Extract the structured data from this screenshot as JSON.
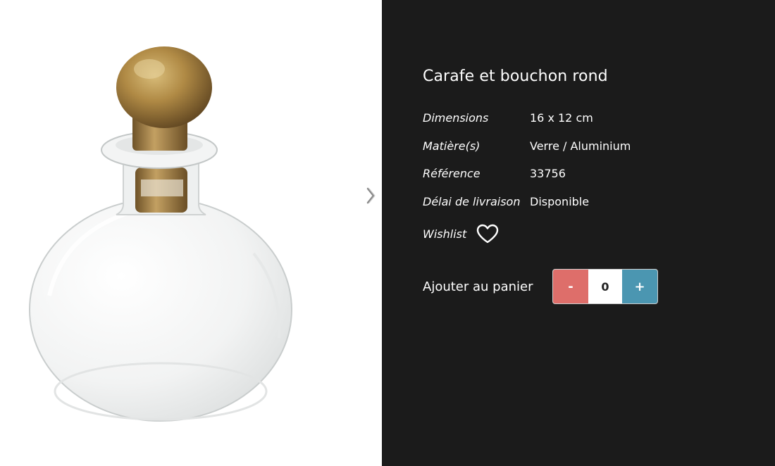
{
  "product": {
    "title": "Carafe et bouchon rond",
    "image_icon": "glass-carafe-with-brass-round-stopper"
  },
  "gallery": {
    "next_icon": "chevron-right-icon"
  },
  "specs": [
    {
      "label": "Dimensions",
      "value": "16 x 12 cm"
    },
    {
      "label": "Matière(s)",
      "value": "Verre / Aluminium"
    },
    {
      "label": "Référence",
      "value": "33756"
    },
    {
      "label": "Délai de livraison",
      "value": "Disponible"
    }
  ],
  "wishlist": {
    "label": "Wishlist",
    "icon": "heart-icon"
  },
  "cart": {
    "label": "Ajouter au panier",
    "minus_label": "-",
    "plus_label": "+",
    "quantity": "0"
  },
  "colors": {
    "info_background": "#1b1b1b",
    "minus_button": "#de6e6a",
    "plus_button": "#4b96b1",
    "stopper_brass": "#b08a45"
  }
}
